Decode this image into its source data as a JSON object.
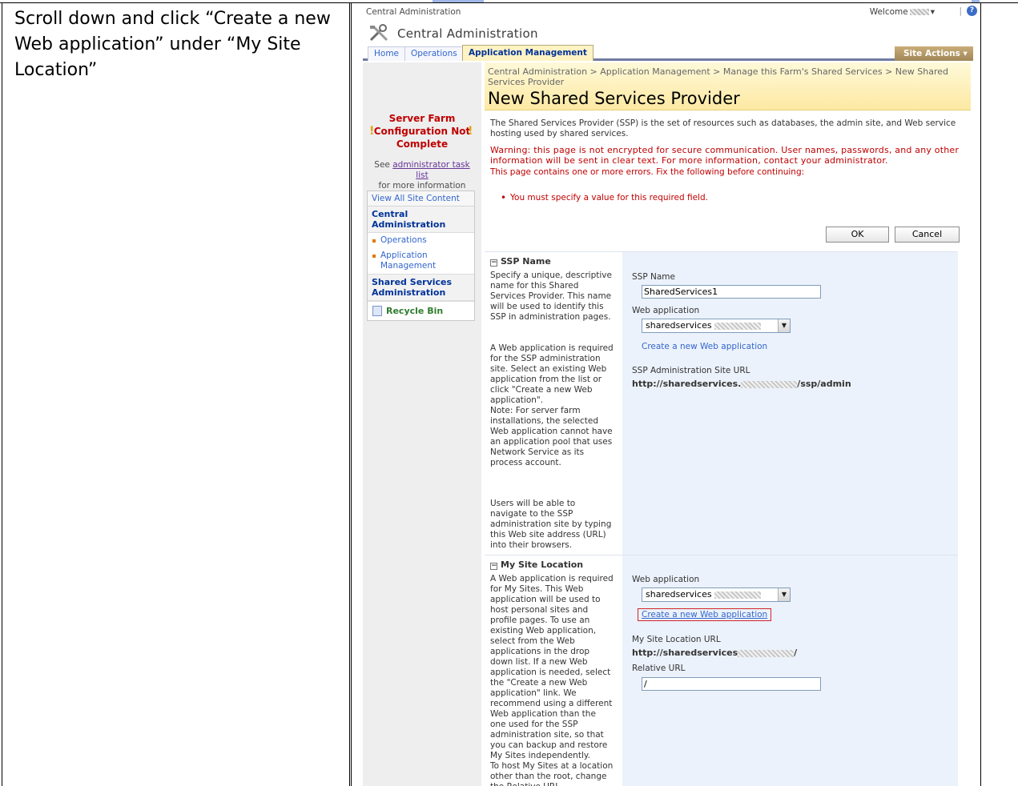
{
  "instruction": "Scroll down and click “Create a new Web application” under “My Site Location”",
  "topbar": {
    "brand": "Central Administration",
    "welcome": "Welcome",
    "separator": "|"
  },
  "site_title": "Central Administration",
  "tabs": {
    "home": "Home",
    "operations": "Operations",
    "application_management": "Application Management"
  },
  "site_actions": "Site Actions ▾",
  "left_nav": {
    "warning": "Server Farm Configuration Not Complete",
    "see": "See",
    "admin_link": "administrator task list",
    "more_info": "for more information",
    "view_all": "View All Site Content",
    "central_admin": "Central Administration",
    "items": [
      "Operations",
      "Application Management"
    ],
    "shared_services": "Shared Services Administration",
    "recycle_bin": "Recycle Bin"
  },
  "page": {
    "breadcrumb": "Central Administration > Application Management > Manage this Farm's Shared Services > New Shared Services Provider",
    "title": "New Shared Services Provider",
    "description": "The Shared Services Provider (SSP) is the set of resources such as databases, the admin site, and Web service hosting used by shared services.",
    "warning": "Warning: this page is not encrypted for secure communication. User names, passwords, and any other information will be sent in clear text. For more information, contact your administrator.",
    "errors_intro": "This page contains one or more errors. Fix the following before continuing:",
    "error_item": "You must specify a value for this required field.",
    "ok": "OK",
    "cancel": "Cancel"
  },
  "ssp_section": {
    "title": "SSP Name",
    "text1": "Specify a unique, descriptive name for this Shared Services Provider. This name will be used to identify this SSP in administration pages.",
    "text2": "A Web application is required for the SSP administration site. Select an existing Web application from the list or click \"Create a new Web application\".\nNote: For server farm installations, the selected Web application cannot have an application pool that uses Network Service as its process account.",
    "text3": "Users will be able to navigate to the SSP administration site by typing this Web site address (URL) into their browsers.",
    "ssp_name_label": "SSP Name",
    "ssp_name_value": "SharedServices1",
    "web_app_label": "Web application",
    "web_app_value": "sharedservices",
    "create_link": "Create a new Web application",
    "admin_url_label": "SSP Administration Site URL",
    "admin_url_prefix": "http://sharedservices.",
    "admin_url_suffix": "/ssp/admin"
  },
  "mysite_section": {
    "title": "My Site Location",
    "text1": "A Web application is required for My Sites. This Web application will be used to host personal sites and profile pages. To use an existing Web application, select from the Web applications in the drop down list. If a new Web application is needed, select the \"Create a new Web application\" link. We recommend using a different Web application than the one used for the SSP administration site, so that you can backup and restore My Sites independently.",
    "text2": "To host My Sites at a location other than the root, change the Relative URL.",
    "web_app_label": "Web application",
    "web_app_value": "sharedservices",
    "create_link": "Create a new Web application",
    "url_label": "My Site Location URL",
    "url_prefix": "http://sharedservices",
    "url_suffix": "/",
    "relative_label": "Relative URL",
    "relative_value": "/"
  },
  "colors": {
    "accent_tab": "#fff3c4",
    "error": "#c00000",
    "link": "#3366cc",
    "highlight_box": "#d0242b"
  }
}
